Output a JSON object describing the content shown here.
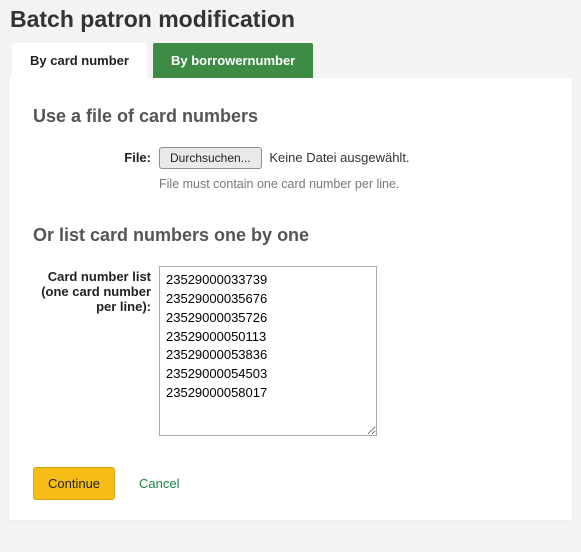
{
  "title": "Batch patron modification",
  "tabs": {
    "active": "By card number",
    "inactive": "By borrowernumber"
  },
  "section1": {
    "heading": "Use a file of card numbers",
    "file_label": "File:",
    "browse_button": "Durchsuchen...",
    "file_status": "Keine Datei ausgewählt.",
    "hint": "File must contain one card number per line."
  },
  "section2": {
    "heading": "Or list card numbers one by one",
    "list_label": "Card number list (one card number per line):",
    "list_value": "23529000033739\n23529000035676\n23529000035726\n23529000050113\n23529000053836\n23529000054503\n23529000058017"
  },
  "actions": {
    "continue": "Continue",
    "cancel": "Cancel"
  }
}
